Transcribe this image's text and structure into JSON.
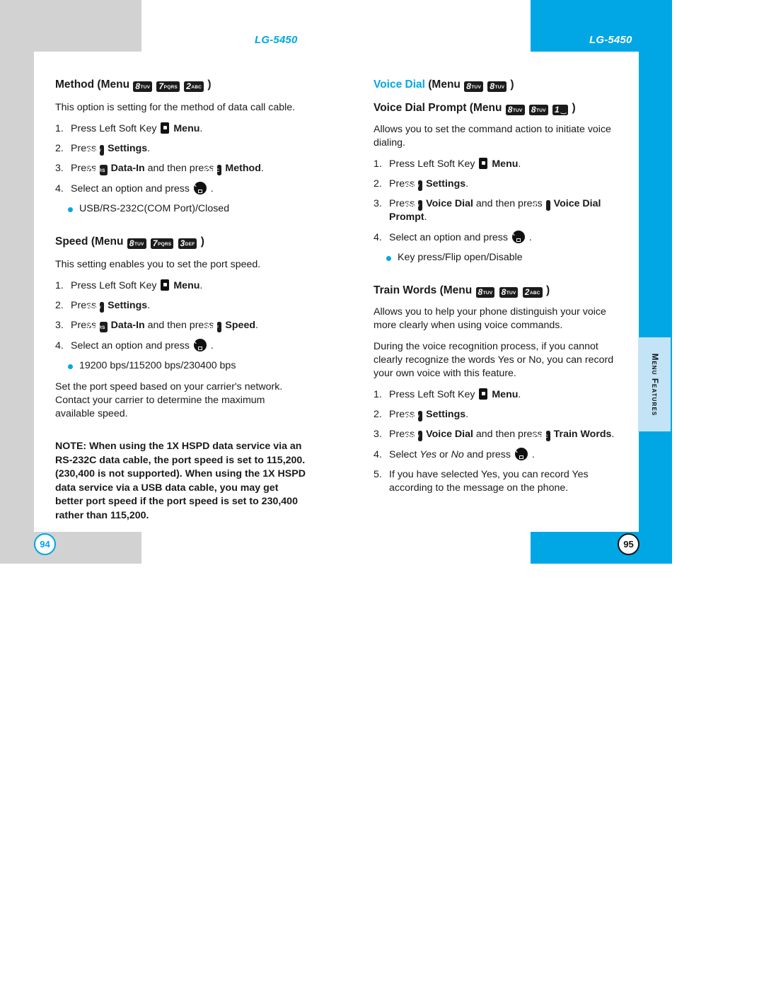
{
  "header": {
    "left_title": "LG-5450",
    "right_title": "LG-5450"
  },
  "side_tab": {
    "label": "Menu Features"
  },
  "pages": {
    "left": "94",
    "right": "95"
  },
  "colors": {
    "accent": "#00a7e4",
    "gray": "#d2d2d2",
    "tab": "#c3e3f7",
    "key": "#1c1c1c"
  },
  "left_column": {
    "method": {
      "heading_text": "Method (Menu",
      "heading_keys": [
        "8 TUV",
        "7 PQRS",
        "2 ABC"
      ],
      "heading_close": ")",
      "intro": "This option is setting for the method of data call cable.",
      "steps": [
        {
          "num": "1.",
          "text_before": "Press Left Soft Key",
          "icon": "soft-key",
          "bold_after": "Menu",
          "text_after": "."
        },
        {
          "num": "2.",
          "text_before": "Press",
          "key": "8 TUV",
          "bold_after": "Settings",
          "text_after": "."
        },
        {
          "num": "3.",
          "text_before": "Press",
          "key": "7 PQRS",
          "bold_mid": "Data-In",
          "text_mid": "and then press",
          "key2": "2 ABC",
          "bold_after": "Method",
          "text_after": "."
        },
        {
          "num": "4.",
          "text_before": "Select an option and press",
          "icon": "ok-key",
          "text_after": "."
        }
      ],
      "options": [
        "USB/RS-232C(COM Port)/Closed"
      ]
    },
    "speed": {
      "heading_text": "Speed (Menu",
      "heading_keys": [
        "8 TUV",
        "7 PQRS",
        "3 DEF"
      ],
      "heading_close": ")",
      "intro": "This setting enables you to set the port speed.",
      "steps": [
        {
          "num": "1.",
          "text_before": "Press Left Soft Key",
          "icon": "soft-key",
          "bold_after": "Menu",
          "text_after": "."
        },
        {
          "num": "2.",
          "text_before": "Press",
          "key": "8 TUV",
          "bold_after": "Settings",
          "text_after": "."
        },
        {
          "num": "3.",
          "text_before": "Press",
          "key": "7 PQRS",
          "bold_mid": "Data-In",
          "text_mid": "and then press",
          "key2": "3 DEF",
          "bold_after": "Speed",
          "text_after": "."
        },
        {
          "num": "4.",
          "text_before": "Select an option and press",
          "icon": "ok-key",
          "text_after": "."
        }
      ],
      "options": [
        "19200 bps/115200 bps/230400 bps"
      ],
      "closing": "Set the port speed based on your carrier's network. Contact your carrier to determine the maximum available speed.",
      "note": "NOTE: When using the 1X HSPD data service via an RS-232C data cable, the port speed is set to 115,200. (230,400 is not supported). When using the 1X HSPD data service via a USB data cable, you may get better port speed if the port speed is set to 230,400 rather than 115,200."
    }
  },
  "right_column": {
    "voice_dial": {
      "heading_blue": "Voice Dial",
      "heading_text": "(Menu",
      "heading_keys": [
        "8 TUV",
        "8 TUV"
      ],
      "heading_close": ")"
    },
    "voice_dial_prompt": {
      "heading_text": "Voice Dial Prompt (Menu",
      "heading_keys": [
        "8 TUV",
        "8 TUV",
        "1"
      ],
      "heading_close": ")",
      "intro": "Allows you to set the command action to initiate voice dialing.",
      "steps": [
        {
          "num": "1.",
          "text_before": "Press Left Soft Key",
          "icon": "soft-key",
          "bold_after": "Menu",
          "text_after": "."
        },
        {
          "num": "2.",
          "text_before": "Press",
          "key": "8 TUV",
          "bold_after": "Settings",
          "text_after": "."
        },
        {
          "num": "3.",
          "text_before": "Press",
          "key": "8 TUV",
          "bold_mid": "Voice Dial",
          "text_mid": "and then press",
          "key2": "1",
          "bold_after": "Voice Dial Prompt",
          "text_after": "."
        },
        {
          "num": "4.",
          "text_before": "Select an option and press",
          "icon": "ok-key",
          "text_after": "."
        }
      ],
      "options": [
        "Key press/Flip open/Disable"
      ]
    },
    "train_words": {
      "heading_text": "Train Words (Menu",
      "heading_keys": [
        "8 TUV",
        "8 TUV",
        "2 ABC"
      ],
      "heading_close": ")",
      "intro": "Allows you to help your phone distinguish your voice more clearly when using voice commands.",
      "intro2": "During the voice recognition process, if you cannot clearly recognize the words Yes or No, you can record your own voice with this feature.",
      "steps": [
        {
          "num": "1.",
          "text_before": "Press Left Soft Key",
          "icon": "soft-key",
          "bold_after": "Menu",
          "text_after": "."
        },
        {
          "num": "2.",
          "text_before": "Press",
          "key": "8 TUV",
          "bold_after": "Settings",
          "text_after": "."
        },
        {
          "num": "3.",
          "text_before": "Press",
          "key": "8 TUV",
          "bold_mid": "Voice Dial",
          "text_mid": "and then press",
          "key2": "2 ABC",
          "bold_after": "Train Words",
          "text_after": "."
        },
        {
          "num": "4.",
          "text_before": "Select",
          "italic1": "Yes",
          "text_mid": "or",
          "italic2": "No",
          "text_mid2": "and press",
          "icon": "ok-key",
          "text_after": "."
        },
        {
          "num": "5.",
          "text_before": "If you have selected Yes, you can record Yes according to the message on the phone."
        }
      ]
    }
  }
}
